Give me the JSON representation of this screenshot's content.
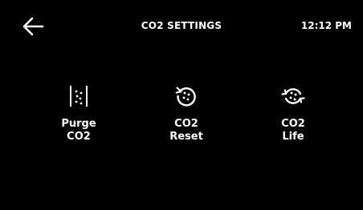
{
  "header": {
    "title": "CO2 SETTINGS",
    "time": "12:12 PM",
    "back_icon": "arrow-left-icon"
  },
  "options": [
    {
      "icon": "purge-co2-icon",
      "line1": "Purge",
      "line2": "CO2"
    },
    {
      "icon": "co2-reset-icon",
      "line1": "CO2",
      "line2": "Reset"
    },
    {
      "icon": "co2-life-icon",
      "line1": "CO2",
      "line2": "Life"
    }
  ],
  "colors": {
    "background": "#000000",
    "foreground": "#ffffff"
  }
}
